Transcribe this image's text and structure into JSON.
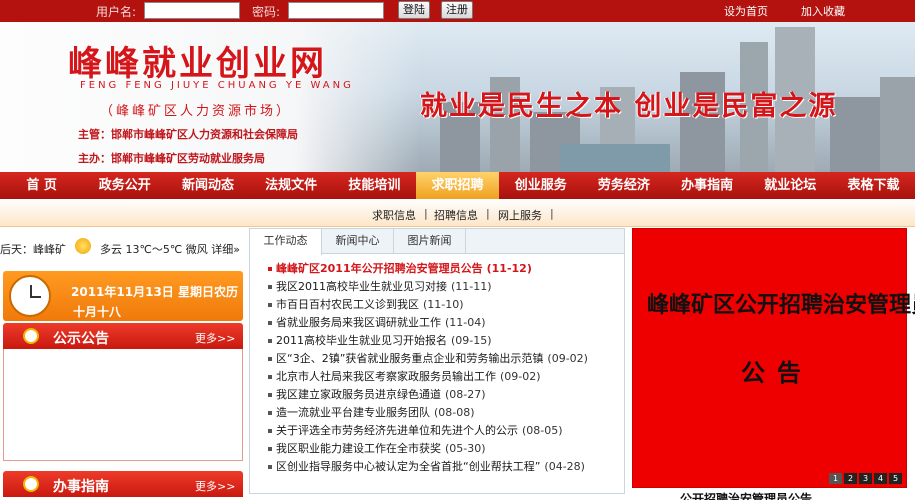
{
  "topbar": {
    "username_label": "用户名:",
    "username_value": "",
    "password_label": "密码:",
    "password_value": "",
    "login_button": "登陆",
    "register_button": "注册",
    "set_homepage": "设为首页",
    "add_favorite": "加入收藏"
  },
  "banner": {
    "title": "峰峰就业创业网",
    "pinyin": "FENG FENG JIUYE CHUANG YE WANG",
    "market": "（峰峰矿区人力资源市场）",
    "org_sponsor": "主管：邯郸市峰峰矿区人力资源和社会保障局",
    "org_host": "主办：邯郸市峰峰矿区劳动就业服务局",
    "slogan": "就业是民生之本 创业是民富之源"
  },
  "nav": {
    "items": [
      "首 页",
      "政务公开",
      "新闻动态",
      "法规文件",
      "技能培训",
      "求职招聘",
      "创业服务",
      "劳务经济",
      "办事指南",
      "就业论坛",
      "表格下载"
    ],
    "active_index": 5
  },
  "subnav": {
    "items": [
      "求职信息",
      "招聘信息",
      "网上服务"
    ]
  },
  "weather": {
    "text_left": "后天：峰峰矿",
    "text_right": "多云 13℃～5℃ 微风 详细»"
  },
  "date": {
    "date_text": "2011年11月13日 星期日农历",
    "lunar": "十月十八"
  },
  "notice": {
    "title": "公示公告",
    "more": "更多>>"
  },
  "guide": {
    "title": "办事指南",
    "more": "更多>>"
  },
  "news": {
    "tabs": [
      "工作动态",
      "新闻中心",
      "图片新闻"
    ],
    "active_tab": 0,
    "items": [
      {
        "title": "峰峰矿区2011年公开招聘治安管理员公告",
        "date": "(11-12)",
        "hot": true
      },
      {
        "title": "我区2011高校毕业生就业见习对接",
        "date": "(11-11)",
        "hot": false
      },
      {
        "title": "市百日百村农民工义诊到我区",
        "date": "(11-10)",
        "hot": false
      },
      {
        "title": "省就业服务局来我区调研就业工作",
        "date": "(11-04)",
        "hot": false
      },
      {
        "title": "2011高校毕业生就业见习开始报名",
        "date": "(09-15)",
        "hot": false
      },
      {
        "title": "区“3企、2镇”获省就业服务重点企业和劳务输出示范镇",
        "date": "(09-02)",
        "hot": false
      },
      {
        "title": "北京市人社局来我区考察家政服务员输出工作",
        "date": "(09-02)",
        "hot": false
      },
      {
        "title": "我区建立家政服务员进京绿色通道",
        "date": "(08-27)",
        "hot": false
      },
      {
        "title": "造一流就业平台建专业服务团队",
        "date": "(08-08)",
        "hot": false
      },
      {
        "title": "关于评选全市劳务经济先进单位和先进个人的公示",
        "date": "(08-05)",
        "hot": false
      },
      {
        "title": "我区职业能力建设工作在全市获奖",
        "date": "(05-30)",
        "hot": false
      },
      {
        "title": "区创业指导服务中心被认定为全省首批“创业帮扶工程”",
        "date": "(04-28)",
        "hot": false
      }
    ]
  },
  "slide": {
    "line1": "峰峰矿区公开招聘治安管理员",
    "line2": "公告",
    "pages": [
      "1",
      "2",
      "3",
      "4",
      "5"
    ],
    "active_page": 0,
    "caption": "公开招聘治安管理员公告"
  },
  "colors": {
    "brand_red": "#d4161b",
    "nav_active": "#f0a020",
    "slide_bg": "#ee0000"
  }
}
